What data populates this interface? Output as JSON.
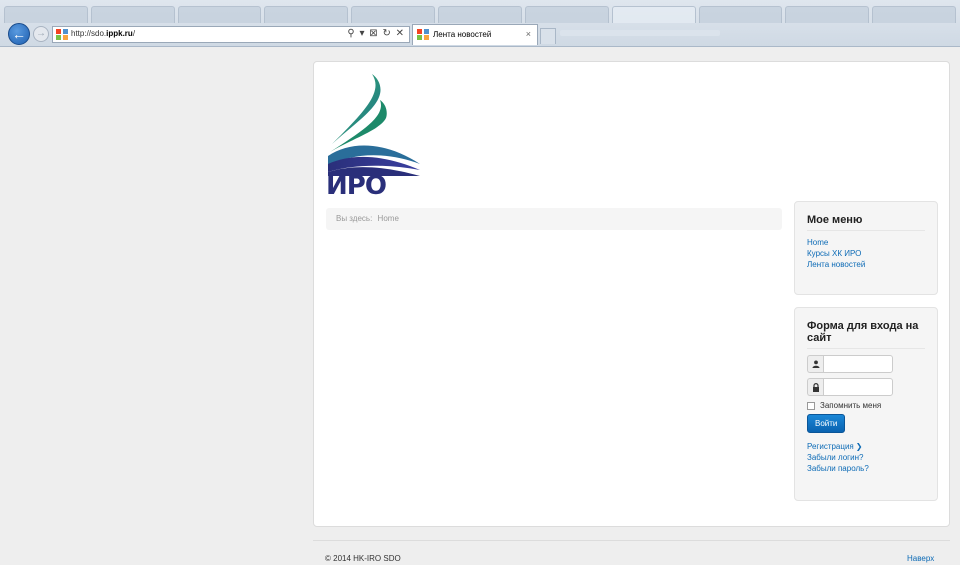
{
  "browser": {
    "url_prefix": "http://sdo.",
    "url_domain": "ippk.ru",
    "url_suffix": "/",
    "address_tools": "⚲ ▾ ⊠ ↻ ✕",
    "active_tab_title": "Лента новостей",
    "tab_close": "×"
  },
  "breadcrumb": {
    "prefix": "Вы здесь:",
    "home": "Home"
  },
  "menu": {
    "title": "Мое меню",
    "items": [
      "Home",
      "Курсы ХК ИРО",
      "Лента новостей"
    ]
  },
  "login": {
    "title": "Форма для входа на сайт",
    "remember_label": "Запомнить меня",
    "submit_label": "Войти",
    "register_link": "Регистрация",
    "forgot_login": "Забыли логин?",
    "forgot_password": "Забыли пароль?"
  },
  "footer": {
    "copyright": "© 2014 HK-IRO SDO",
    "back_to_top": "Наверх"
  },
  "colors": {
    "link": "#0d6bb6",
    "button": "#0a63b0",
    "logo_green": "#1f9a5a",
    "logo_navy": "#2a2f7a"
  }
}
